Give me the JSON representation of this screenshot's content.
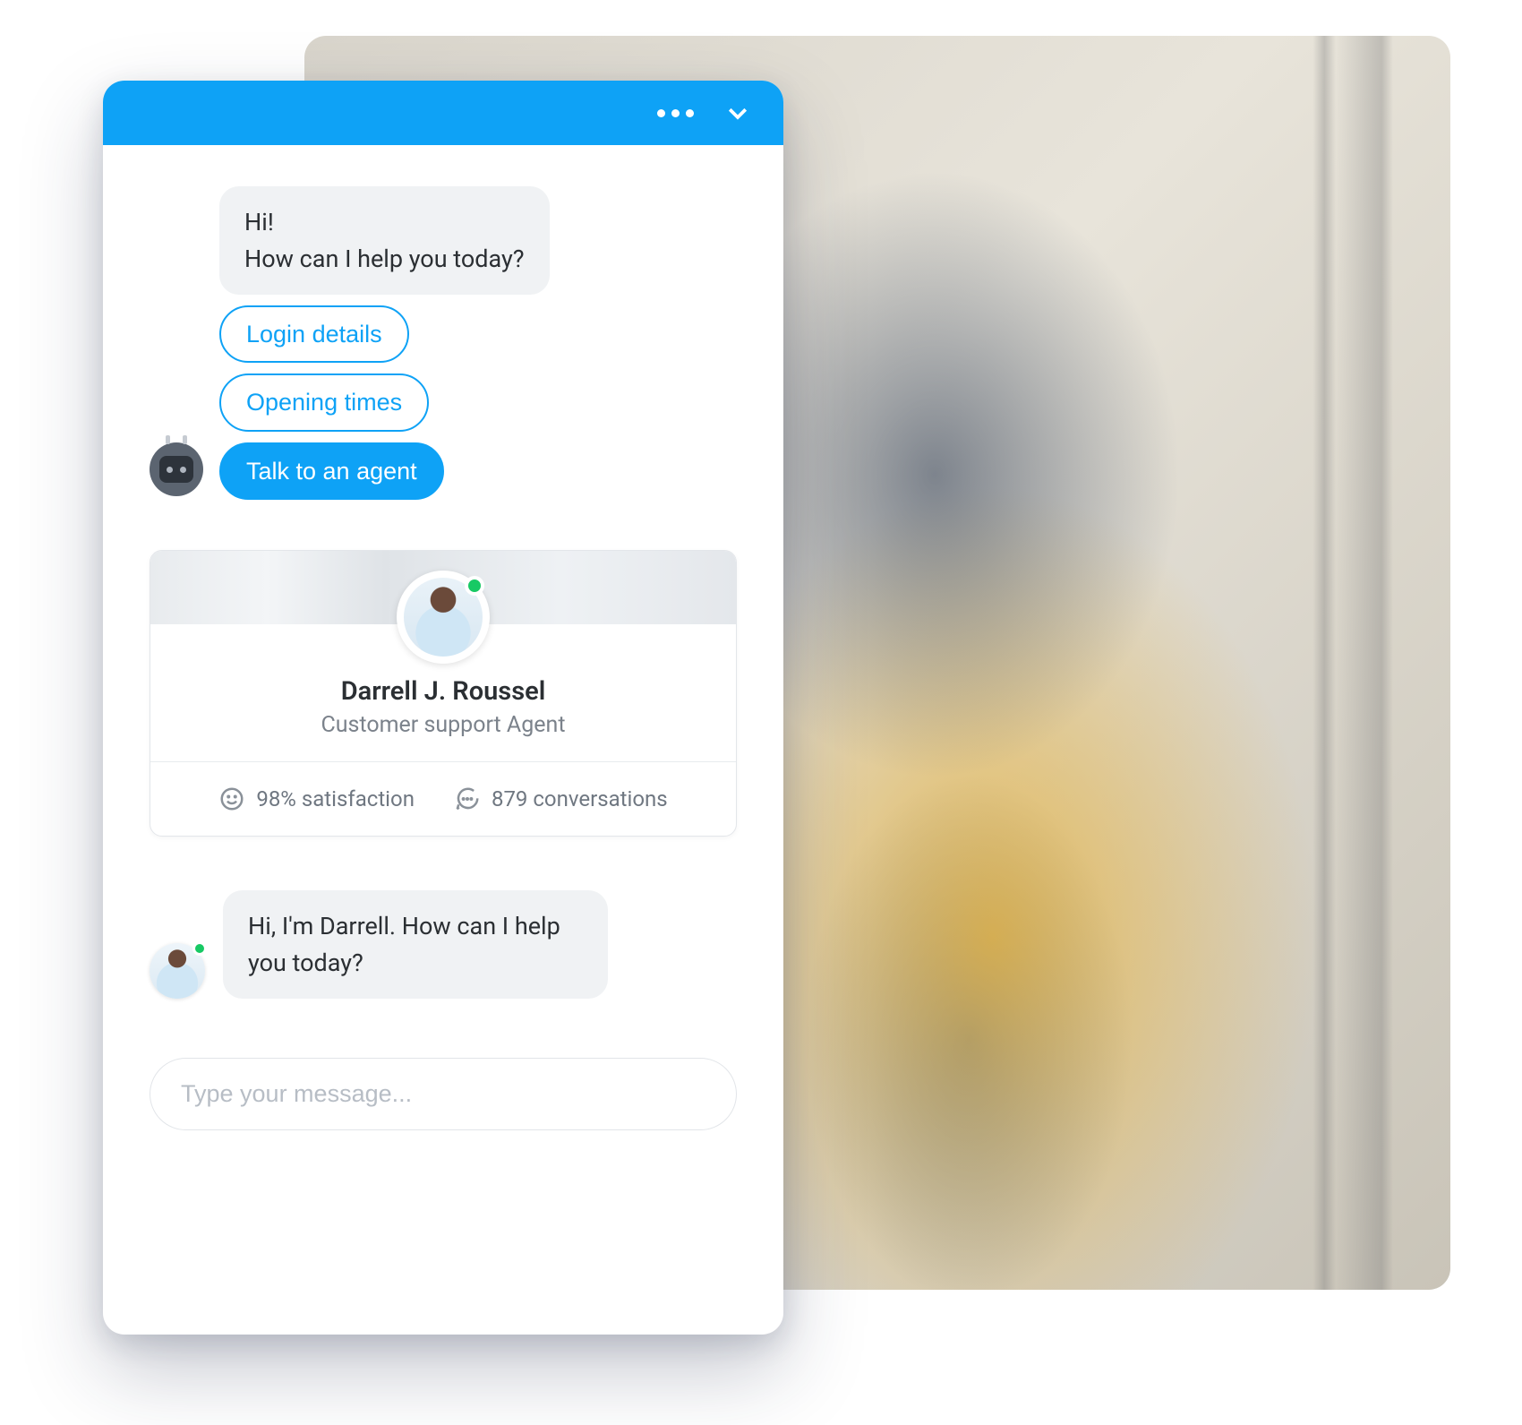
{
  "header": {
    "more_icon": "more-horizontal-icon",
    "collapse_icon": "chevron-down-icon"
  },
  "bot": {
    "greeting_line1": "Hi!",
    "greeting_line2": "How can I help you today?",
    "quick_replies": [
      {
        "label": "Login details",
        "selected": false
      },
      {
        "label": "Opening times",
        "selected": false
      },
      {
        "label": "Talk to an agent",
        "selected": true
      }
    ]
  },
  "agent_card": {
    "name": "Darrell J. Roussel",
    "role": "Customer support Agent",
    "satisfaction": "98% satisfaction",
    "conversations": "879 conversations",
    "status": "online"
  },
  "agent_message": "Hi, I'm Darrell. How can I help you today?",
  "input": {
    "placeholder": "Type your message..."
  },
  "colors": {
    "primary": "#0ea2f6",
    "online": "#17c964"
  }
}
